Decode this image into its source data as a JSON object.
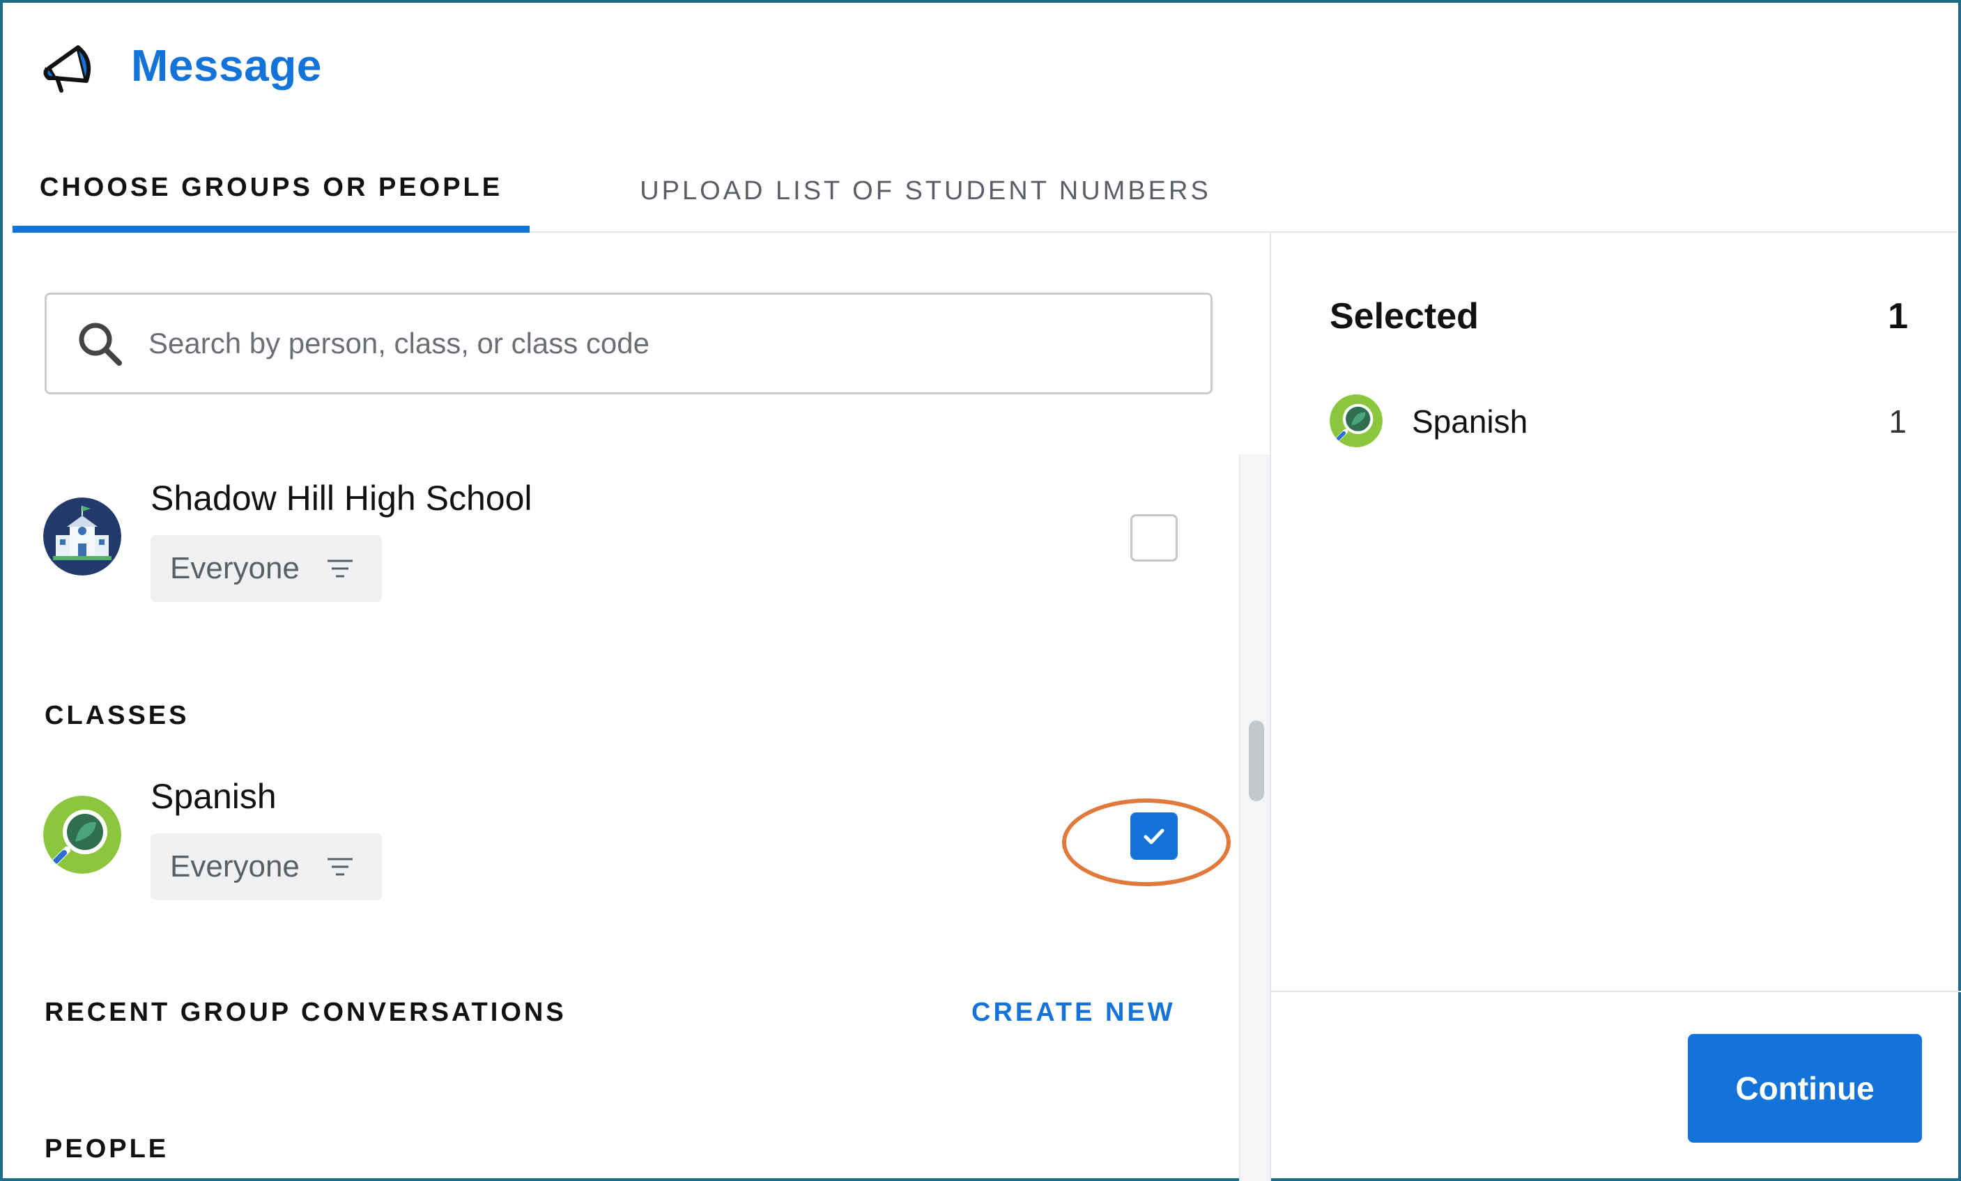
{
  "header": {
    "title": "Message",
    "icon": "megaphone-icon"
  },
  "tabs": [
    {
      "label": "CHOOSE GROUPS OR PEOPLE",
      "active": true
    },
    {
      "label": "UPLOAD LIST OF STUDENT NUMBERS",
      "active": false
    }
  ],
  "search": {
    "placeholder": "Search by person, class, or class code",
    "value": ""
  },
  "schools": [
    {
      "name": "Shadow Hill High School",
      "audience": "Everyone",
      "checked": false
    }
  ],
  "sections": {
    "classes": "CLASSES",
    "recent_groups": "RECENT GROUP CONVERSATIONS",
    "create_new": "CREATE NEW",
    "people": "PEOPLE"
  },
  "classes": [
    {
      "name": "Spanish",
      "audience": "Everyone",
      "checked": true
    }
  ],
  "selected": {
    "title": "Selected",
    "count": "1",
    "items": [
      {
        "name": "Spanish",
        "count": "1"
      }
    ]
  },
  "actions": {
    "continue_label": "Continue"
  },
  "colors": {
    "accent": "#1473d9",
    "highlight": "#e07a3c",
    "frame": "#1f6b8a"
  }
}
